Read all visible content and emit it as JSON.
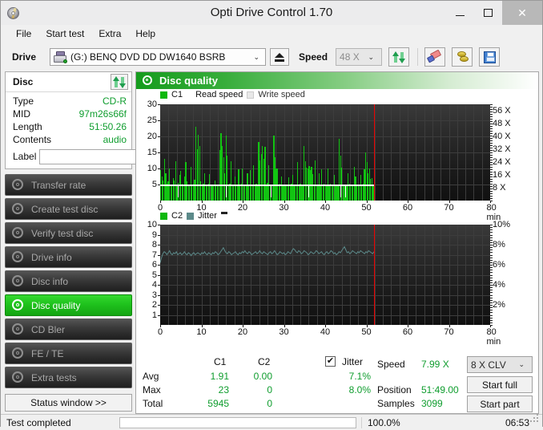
{
  "window": {
    "title": "Opti Drive Control 1.70",
    "icon": "disc-icon",
    "minimize": "–",
    "maximize": "□",
    "close": "✕"
  },
  "menubar": {
    "items": [
      {
        "label": "File"
      },
      {
        "label": "Start test"
      },
      {
        "label": "Extra"
      },
      {
        "label": "Help"
      }
    ]
  },
  "toolbar": {
    "drive_label": "Drive",
    "drive_value": "(G:)   BENQ DVD DD DW1640 BSRB",
    "drive_arrow": "⌄",
    "eject_title": "eject",
    "speed_label": "Speed",
    "speed_value": "48 X",
    "speed_arrow": "⌄",
    "buttons": [
      {
        "name": "refresh-icon"
      },
      {
        "name": "eraser-icon"
      },
      {
        "name": "gold-discs-icon"
      },
      {
        "name": "save-icon"
      }
    ]
  },
  "sidebar": {
    "disc_panel": {
      "title": "Disc",
      "refresh_icon": "refresh-icon",
      "rows": [
        {
          "key": "Type",
          "value": "CD-R"
        },
        {
          "key": "MID",
          "value": "97m26s66f"
        },
        {
          "key": "Length",
          "value": "51:50.26"
        },
        {
          "key": "Contents",
          "value": "audio"
        }
      ],
      "label_key": "Label",
      "label_value": "",
      "label_placeholder": "",
      "label_button_icon": "cd-icon"
    },
    "nav_items": [
      {
        "label": "Transfer rate",
        "active": false
      },
      {
        "label": "Create test disc",
        "active": false
      },
      {
        "label": "Verify test disc",
        "active": false
      },
      {
        "label": "Drive info",
        "active": false
      },
      {
        "label": "Disc info",
        "active": false
      },
      {
        "label": "Disc quality",
        "active": true
      },
      {
        "label": "CD Bler",
        "active": false
      },
      {
        "label": "FE / TE",
        "active": false
      },
      {
        "label": "Extra tests",
        "active": false
      }
    ],
    "status_window_button": "Status window >>"
  },
  "content": {
    "header_title": "Disc quality",
    "header_icon": "disc-quality-icon"
  },
  "chart_data": [
    {
      "type": "bar",
      "id": "c1-chart",
      "title": "",
      "legend": [
        {
          "label": "C1",
          "color": "#0db80d"
        },
        {
          "label": "Read speed",
          "color": "#ffffff"
        },
        {
          "label": "Write speed",
          "color": "#e8e8e8"
        }
      ],
      "xlabel": "min",
      "ylabel": "",
      "xlim": [
        0,
        80
      ],
      "ylim": [
        0,
        30
      ],
      "xticks": [
        0,
        10,
        20,
        30,
        40,
        50,
        60,
        70,
        80
      ],
      "xtick_labels": [
        "0",
        "10",
        "20",
        "30",
        "40",
        "50",
        "60",
        "70",
        "80 min"
      ],
      "yticks": [
        5,
        10,
        15,
        20,
        25,
        30
      ],
      "ytick_labels": [
        "5",
        "10",
        "15",
        "20",
        "25",
        "30"
      ],
      "right_axis": {
        "label": "X",
        "ticks": [
          8,
          16,
          24,
          32,
          40,
          48,
          56
        ],
        "tick_labels": [
          "8 X",
          "16 X",
          "24 X",
          "32 X",
          "40 X",
          "48 X",
          "56 X"
        ],
        "lim": [
          0,
          60
        ]
      },
      "grid": true,
      "data_end_min": 51.84,
      "marker_min": 51.84,
      "marker_color": "#ee0000",
      "read_speed_value": 8,
      "values": [
        9.5,
        7.6,
        6.2,
        13.0,
        8.4,
        5.3,
        6.1,
        9.9,
        5.0,
        4.6,
        7.1,
        6.3,
        12.2,
        4.9,
        5.5,
        8.0,
        9.3,
        5.2,
        4.8,
        7.4,
        12.1,
        6.0,
        4.6,
        5.1,
        10.6,
        4.9,
        5.2,
        6.6,
        23.0,
        15.9,
        20.4,
        17.0,
        6.1,
        4.7,
        5.3,
        8.6,
        5.0,
        4.6,
        5.2,
        8.3,
        4.7,
        5.0,
        4.6,
        6.3,
        5.1,
        4.6,
        4.9,
        15.7,
        21.1,
        17.1,
        13.5,
        8.5,
        20.2,
        14.0,
        4.8,
        5.2,
        12.3,
        4.7,
        5.0,
        7.6,
        4.6,
        5.1,
        9.8,
        4.7,
        5.3,
        10.0,
        4.9,
        4.6,
        5.1,
        8.5,
        4.7,
        9.6,
        4.6,
        5.0,
        11.0,
        4.8,
        5.2,
        4.7,
        18.3,
        12.6,
        14.4,
        16.9,
        13.0,
        16.8,
        4.9,
        5.4,
        11.1,
        4.7,
        5.0,
        4.6,
        20.2,
        13.5,
        10.0,
        10.1,
        4.8,
        5.2,
        7.6,
        4.6,
        5.1,
        4.7,
        5.0,
        4.9,
        7.3,
        4.6,
        5.3,
        8.0,
        4.7,
        5.1,
        4.6,
        11.9,
        4.9,
        5.2,
        4.7,
        5.0,
        16.9,
        12.2,
        10.2,
        9.9,
        10.8,
        9.6,
        10.4,
        8.2,
        4.7,
        12.4,
        4.9,
        5.1,
        8.6,
        4.6,
        9.8,
        4.7,
        5.2,
        4.9,
        5.0,
        10.0,
        4.6,
        5.3,
        4.7,
        5.1,
        8.1,
        4.9,
        4.6,
        5.0,
        19.2,
        14.0,
        10.2,
        5.1,
        4.7,
        4.9,
        4.6,
        8.6,
        5.2,
        4.8,
        5.0,
        4.7,
        10.5,
        7.5,
        4.9,
        5.1,
        4.6,
        8.0,
        4.7,
        5.3,
        9.8,
        15.1,
        12.1,
        8.4,
        10.0,
        6.8,
        7.0,
        5.1
      ],
      "read_speed_series_note": "white line near 5 on left axis (~8X) flat across recorded area"
    },
    {
      "type": "line",
      "id": "c2-jitter-chart",
      "title": "",
      "legend": [
        {
          "label": "C2",
          "color": "#0db80d"
        },
        {
          "label": "Jitter",
          "color": "#5c8a8a"
        }
      ],
      "xlabel": "min",
      "xlim": [
        0,
        80
      ],
      "ylim": [
        0,
        10
      ],
      "xticks": [
        0,
        10,
        20,
        30,
        40,
        50,
        60,
        70,
        80
      ],
      "xtick_labels": [
        "0",
        "10",
        "20",
        "30",
        "40",
        "50",
        "60",
        "70",
        "80 min"
      ],
      "yticks": [
        1,
        2,
        3,
        4,
        5,
        6,
        7,
        8,
        9,
        10
      ],
      "ytick_labels": [
        "1",
        "2",
        "3",
        "4",
        "5",
        "6",
        "7",
        "8",
        "9",
        "10"
      ],
      "right_axis": {
        "ticks": [
          2,
          4,
          6,
          8,
          10
        ],
        "tick_labels": [
          "2%",
          "4%",
          "6%",
          "8%",
          "10%"
        ],
        "lim": [
          0,
          10
        ]
      },
      "grid": true,
      "data_end_min": 51.84,
      "marker_min": 51.84,
      "marker_color": "#ee0000",
      "c2_values_all_zero": true,
      "jitter_series": {
        "name": "Jitter",
        "color": "#5c8a8a",
        "values": [
          6.2,
          6.7,
          7.1,
          7.3,
          7.2,
          7.0,
          7.2,
          7.4,
          7.1,
          7.0,
          7.2,
          7.1,
          7.3,
          7.0,
          7.1,
          7.2,
          7.0,
          7.1,
          7.3,
          7.1,
          7.0,
          7.2,
          7.1,
          6.9,
          7.1,
          7.2,
          7.0,
          7.1,
          7.2,
          7.1,
          7.0,
          7.2,
          7.1,
          7.3,
          7.1,
          7.0,
          7.2,
          7.1,
          7.0,
          7.2,
          7.1,
          7.3,
          7.2,
          7.0,
          7.1,
          7.3,
          7.5,
          7.7,
          7.4,
          7.2,
          7.1,
          7.3,
          7.2,
          7.0,
          7.1,
          7.2,
          7.3,
          7.1,
          7.0,
          7.2,
          7.1,
          7.3,
          7.2,
          7.4,
          7.2,
          7.1,
          7.3,
          7.2,
          7.0,
          7.1,
          7.2,
          7.3,
          7.1,
          7.2,
          7.4,
          7.2,
          7.1,
          7.3,
          7.2,
          7.1,
          7.0,
          7.2,
          7.3,
          7.1,
          7.2,
          7.4,
          7.2,
          7.0,
          7.1,
          7.3,
          7.2,
          7.1,
          7.2,
          7.0,
          7.1,
          7.3,
          7.2,
          7.1,
          7.4,
          7.6,
          7.5,
          7.3,
          7.2,
          7.4,
          7.3,
          7.1,
          7.2,
          7.4,
          7.3,
          7.2,
          7.0,
          7.1,
          7.3,
          7.2,
          7.1,
          7.2,
          7.4,
          7.3,
          7.1,
          7.2,
          7.3,
          7.1,
          7.0,
          7.2,
          7.3,
          7.1,
          7.2,
          7.4,
          7.3,
          7.1,
          7.2,
          7.0,
          7.1,
          7.3,
          7.2,
          7.4,
          7.6,
          7.8,
          7.5,
          7.2,
          7.3,
          7.1,
          7.2,
          7.4,
          7.3,
          7.2,
          7.1,
          7.3,
          7.2,
          7.4,
          7.3,
          7.2,
          7.1,
          7.3,
          7.2,
          7.4,
          7.3,
          7.2,
          7.1,
          7.3
        ]
      }
    }
  ],
  "stats": {
    "col_headers": [
      "C1",
      "C2"
    ],
    "rows": [
      {
        "label": "Avg",
        "c1": "1.91",
        "c2": "0.00",
        "jitter": "7.1%"
      },
      {
        "label": "Max",
        "c1": "23",
        "c2": "0",
        "jitter": "8.0%"
      },
      {
        "label": "Total",
        "c1": "5945",
        "c2": "0",
        "jitter": ""
      }
    ],
    "jitter_checkbox_label": "Jitter",
    "jitter_checked": true,
    "jitter_check_glyph": "✔",
    "right_rows": [
      {
        "label": "Speed",
        "value": "7.99 X"
      },
      {
        "label": "Position",
        "value": "51:49.00"
      },
      {
        "label": "Samples",
        "value": "3099"
      }
    ],
    "clv_value": "8 X CLV",
    "clv_arrow": "⌄",
    "start_full_label": "Start full",
    "start_part_label": "Start part"
  },
  "statusbar": {
    "text": "Test completed",
    "progress_pct": 100.0,
    "progress_label": "100.0%",
    "elapsed": "06:53"
  },
  "colors": {
    "accent_green": "#0f9d2e",
    "bar_green": "#12c412",
    "jitter_teal": "#5c8a8a",
    "marker_red": "#ee0000",
    "header_green": "#159c1d"
  }
}
